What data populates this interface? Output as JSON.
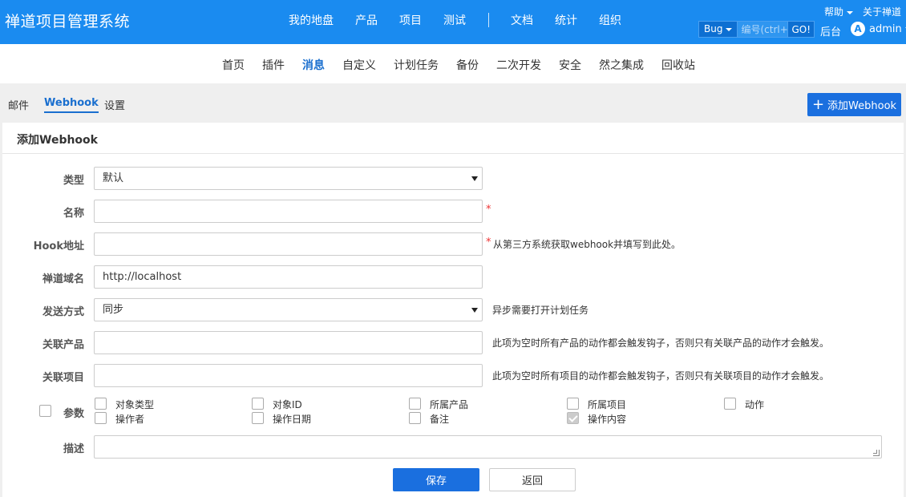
{
  "header": {
    "brand": "禅道项目管理系统",
    "nav": [
      "我的地盘",
      "产品",
      "项目",
      "测试",
      "文档",
      "统计",
      "组织"
    ],
    "help": "帮助",
    "about": "关于禅道",
    "search_type": "Bug",
    "search_placeholder": "编号(ctrl+g)",
    "search_go": "GO!",
    "admin_link": "后台",
    "avatar_initial": "A",
    "user": "admin"
  },
  "subnav": {
    "items": [
      "首页",
      "插件",
      "消息",
      "自定义",
      "计划任务",
      "备份",
      "二次开发",
      "安全",
      "然之集成",
      "回收站"
    ],
    "active": "消息"
  },
  "tabs": {
    "items": [
      "邮件",
      "Webhook",
      "设置"
    ],
    "active": "Webhook",
    "add_button": "添加Webhook"
  },
  "form": {
    "title": "添加Webhook",
    "type_label": "类型",
    "type_value": "默认",
    "name_label": "名称",
    "name_value": "",
    "hook_label": "Hook地址",
    "hook_value": "",
    "hook_help": "从第三方系统获取webhook并填写到此处。",
    "domain_label": "禅道域名",
    "domain_value": "http://localhost",
    "send_label": "发送方式",
    "send_value": "同步",
    "send_help": "异步需要打开计划任务",
    "product_label": "关联产品",
    "product_value": "",
    "product_help": "此项为空时所有产品的动作都会触发钩子，否则只有关联产品的动作才会触发。",
    "project_label": "关联项目",
    "project_value": "",
    "project_help": "此项为空时所有项目的动作都会触发钩子，否则只有关联项目的动作才会触发。",
    "params_label": "参数",
    "params": [
      {
        "label": "对象类型",
        "checked": false
      },
      {
        "label": "对象ID",
        "checked": false
      },
      {
        "label": "所属产品",
        "checked": false
      },
      {
        "label": "所属项目",
        "checked": false
      },
      {
        "label": "动作",
        "checked": false
      },
      {
        "label": "操作者",
        "checked": false
      },
      {
        "label": "操作日期",
        "checked": false
      },
      {
        "label": "备注",
        "checked": false
      },
      {
        "label": "操作内容",
        "checked": true
      }
    ],
    "desc_label": "描述",
    "desc_value": "",
    "save": "保存",
    "back": "返回"
  },
  "colors": {
    "header_bg": "#1a8bf0",
    "primary": "#1a6fdf",
    "required": "#e33333"
  }
}
